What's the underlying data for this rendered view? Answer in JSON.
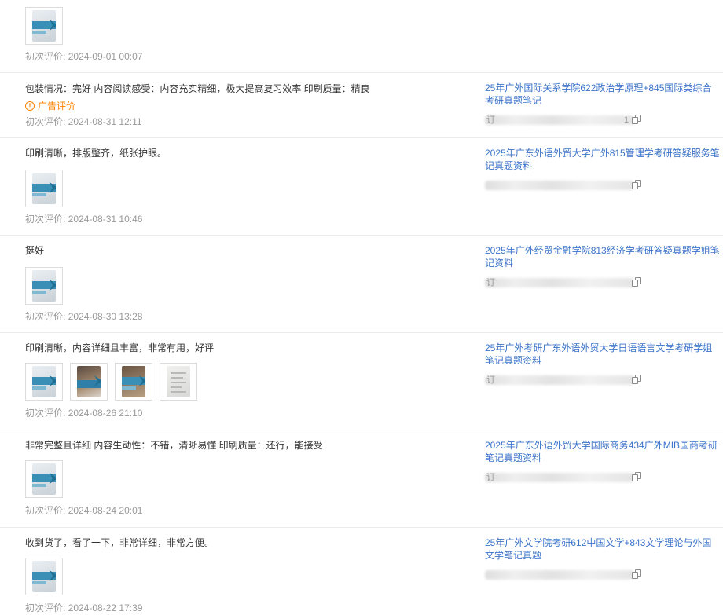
{
  "labels": {
    "first_review_prefix": "初次评价:",
    "ad_badge": "广告评价",
    "ad_icon_glyph": "!"
  },
  "colors": {
    "link": "#3b73c8",
    "meta": "#999999",
    "ad": "#ff8000"
  },
  "reviews": [
    {
      "content": "",
      "timestamp": "2024-09-01 00:07",
      "thumbnails": [
        "book-cover"
      ],
      "product": null
    },
    {
      "content": "包装情况：完好 内容阅读感受：内容充实精细，极大提高复习效率 印刷质量：精良",
      "ad": true,
      "timestamp": "2024-08-31 12:11",
      "thumbnails": [],
      "product": {
        "title": "25年广外国际关系学院622政治学原理+845国际类综合考研真题笔记",
        "spec_text": "订",
        "spec_tail": "1"
      }
    },
    {
      "content": "印刷清晰，排版整齐，纸张护眼。",
      "timestamp": "2024-08-31 10:46",
      "thumbnails": [
        "book-cover"
      ],
      "product": {
        "title": "2025年广东外语外贸大学广外815管理学考研答疑服务笔记真题资料",
        "spec_text": "",
        "spec_tail": ""
      }
    },
    {
      "content": "挺好",
      "timestamp": "2024-08-30 13:28",
      "thumbnails": [
        "book-cover"
      ],
      "product": {
        "title": "2025年广外经贸金融学院813经济学考研答疑真题学姐笔记资料",
        "spec_text": "订",
        "spec_tail": ""
      }
    },
    {
      "content": "印刷清晰，内容详细且丰富，非常有用，好评",
      "timestamp": "2024-08-26 21:10",
      "thumbnails": [
        "book-cover",
        "book-dark",
        "book-cover",
        "paper-sheet"
      ],
      "product": {
        "title": "25年广外考研广东外语外贸大学日语语言文学考研学姐笔记真题资料",
        "spec_text": "订",
        "spec_tail": ""
      }
    },
    {
      "content": "非常完整且详细 内容生动性：不错，清晰易懂 印刷质量：还行，能接受",
      "timestamp": "2024-08-24 20:01",
      "thumbnails": [
        "book-cover"
      ],
      "product": {
        "title": "2025年广东外语外贸大学国际商务434广外MIB国商考研笔记真题资料",
        "spec_text": "订",
        "spec_tail": ""
      }
    },
    {
      "content": "收到货了，看了一下，非常详细，非常方便。",
      "timestamp": "2024-08-22 17:39",
      "thumbnails": [
        "book-cover"
      ],
      "product": {
        "title": "25年广外文学院考研612中国文学+843文学理论与外国文学笔记真题",
        "spec_text": "",
        "spec_tail": ""
      }
    }
  ]
}
